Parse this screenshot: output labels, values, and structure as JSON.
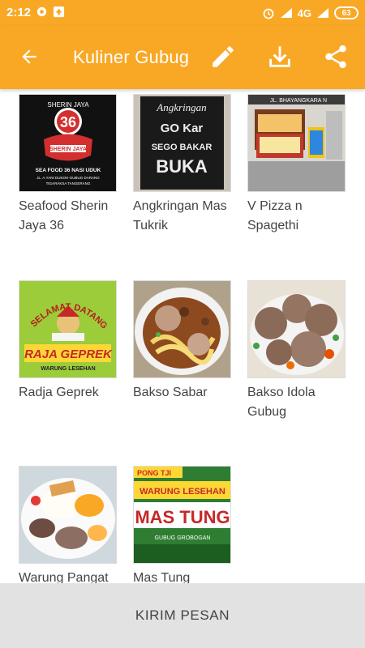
{
  "status_bar": {
    "time": "2:12",
    "network": "4G",
    "battery": "63"
  },
  "toolbar": {
    "title": "Kuliner Gubug",
    "back_icon": "arrow-back-icon",
    "edit_icon": "pencil-icon",
    "download_icon": "download-icon",
    "share_icon": "share-icon",
    "color": "#f9a825"
  },
  "items": [
    {
      "label": "Seafood Sherin Jaya 36",
      "image": {
        "top": "SHERIN JAYA",
        "num": "36",
        "badge": "SHERIN JAYA",
        "line1": "SEA FOOD 36 NASI UDUK",
        "line2": "JL. A.YANI DUKOH-GUBUG DARANG",
        "line3": "TIGARAKSA TANGERANG"
      }
    },
    {
      "label": "Angkringan Mas Tukrik",
      "image": {
        "line1": "Angkringan",
        "line2": "GO Kar",
        "line3": "SEGO BAKAR",
        "line4": "BUKA"
      }
    },
    {
      "label": "V Pizza n Spagethi",
      "image": {
        "street": "JL. BHAYANGKARA N"
      }
    },
    {
      "label": "Radja Geprek",
      "image": {
        "arc": "SELAMAT DATANG",
        "brand": "RAJA GEPREK",
        "sub": "WARUNG LESEHAN"
      }
    },
    {
      "label": "Bakso Sabar",
      "image": {}
    },
    {
      "label": "Bakso Idola Gubug",
      "image": {}
    },
    {
      "label": "Warung Pangat",
      "image": {}
    },
    {
      "label": "Mas Tung",
      "image": {
        "top": "PONG TJI",
        "line1": "WARUNG LESEHAN",
        "line2": "MAS TUNG",
        "line3": "GUBUG GROBOGAN"
      }
    }
  ],
  "footer": {
    "button_label": "KIRIM PESAN"
  }
}
